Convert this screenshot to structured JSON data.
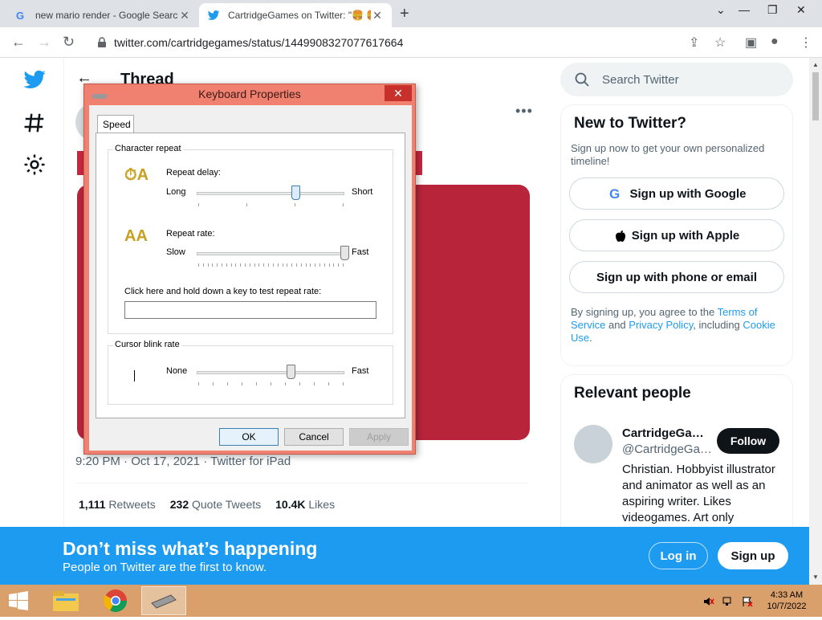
{
  "browser": {
    "tabs": [
      {
        "title": "new mario render - Google Searc",
        "active": false
      },
      {
        "title": "CartridgeGames on Twitter: \"🍔 🍔",
        "active": true
      }
    ],
    "url": "twitter.com/cartridgegames/status/1449908327077617664"
  },
  "twitter": {
    "header_title": "Thread",
    "tweet_meta": "9:20 PM · Oct 17, 2021 · Twitter for iPad",
    "stats": [
      {
        "count": "1,111",
        "label": "Retweets"
      },
      {
        "count": "232",
        "label": "Quote Tweets"
      },
      {
        "count": "10.4K",
        "label": "Likes"
      }
    ],
    "search_placeholder": "Search Twitter",
    "new_card": {
      "title": "New to Twitter?",
      "subtitle": "Sign up now to get your own personalized timeline!",
      "google": "Sign up with Google",
      "apple": "Sign up with Apple",
      "phone": "Sign up with phone or email",
      "legal_1": "By signing up, you agree to the ",
      "terms": "Terms of Service",
      "legal_2": " and ",
      "privacy": "Privacy Policy",
      "legal_3": ", including ",
      "cookie": "Cookie Use",
      "legal_4": "."
    },
    "relevant": {
      "title": "Relevant people",
      "name": "CartridgeGa…",
      "handle": "@CartridgeGa…",
      "follow": "Follow",
      "bio": "Christian. Hobbyist illustrator and animator as well as an aspiring writer. Likes videogames. Art only"
    },
    "banner": {
      "headline": "Don’t miss what’s happening",
      "sub": "People on Twitter are the first to know.",
      "login": "Log in",
      "signup": "Sign up"
    }
  },
  "dialog": {
    "title": "Keyboard Properties",
    "tab": "Speed",
    "char_repeat_group": "Character repeat",
    "repeat_delay_label": "Repeat delay:",
    "long": "Long",
    "short": "Short",
    "repeat_rate_label": "Repeat rate:",
    "slow": "Slow",
    "fast": "Fast",
    "test_label": "Click here and hold down a key to test repeat rate:",
    "cursor_group": "Cursor blink rate",
    "none": "None",
    "fast2": "Fast",
    "ok": "OK",
    "cancel": "Cancel",
    "apply": "Apply",
    "repeat_delay_value": 0.67,
    "repeat_rate_value": 1.0,
    "cursor_blink_value": 0.64
  },
  "taskbar": {
    "time": "4:33 AM",
    "date": "10/7/2022"
  }
}
